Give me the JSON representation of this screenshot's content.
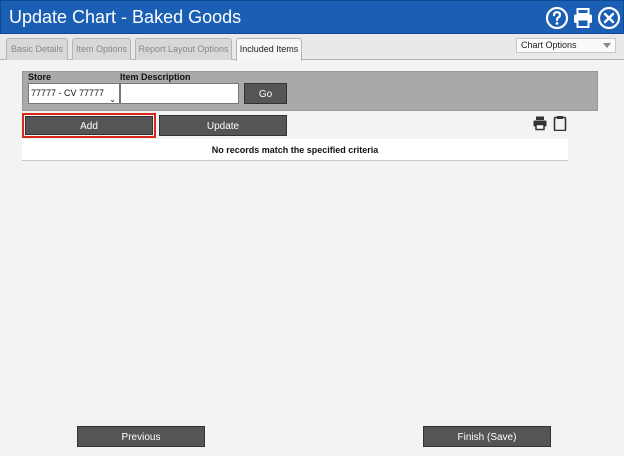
{
  "window": {
    "title": "Update Chart - Baked Goods",
    "icons": [
      "help-icon",
      "print-icon",
      "close-icon"
    ]
  },
  "tabs": [
    {
      "label": "Basic Details",
      "active": false
    },
    {
      "label": "Item Options",
      "active": false
    },
    {
      "label": "Report Layout Options",
      "active": false
    },
    {
      "label": "Included Items",
      "active": true
    }
  ],
  "chart_options": {
    "selected": "Chart Options"
  },
  "filter": {
    "store_label": "Store",
    "store_value": "77777 - CV 77777",
    "item_desc_label": "Item Description",
    "item_desc_value": "",
    "go_label": "Go"
  },
  "actions": {
    "add_label": "Add",
    "update_label": "Update",
    "icons": [
      "print-icon",
      "clipboard-icon"
    ]
  },
  "table": {
    "empty_message": "No records match the specified criteria"
  },
  "footer": {
    "previous_label": "Previous",
    "finish_label": "Finish (Save)"
  },
  "colors": {
    "titlebar": "#1a5fb4",
    "button": "#555555",
    "highlight": "#d9291c",
    "filterbar": "#a9a9a9"
  }
}
